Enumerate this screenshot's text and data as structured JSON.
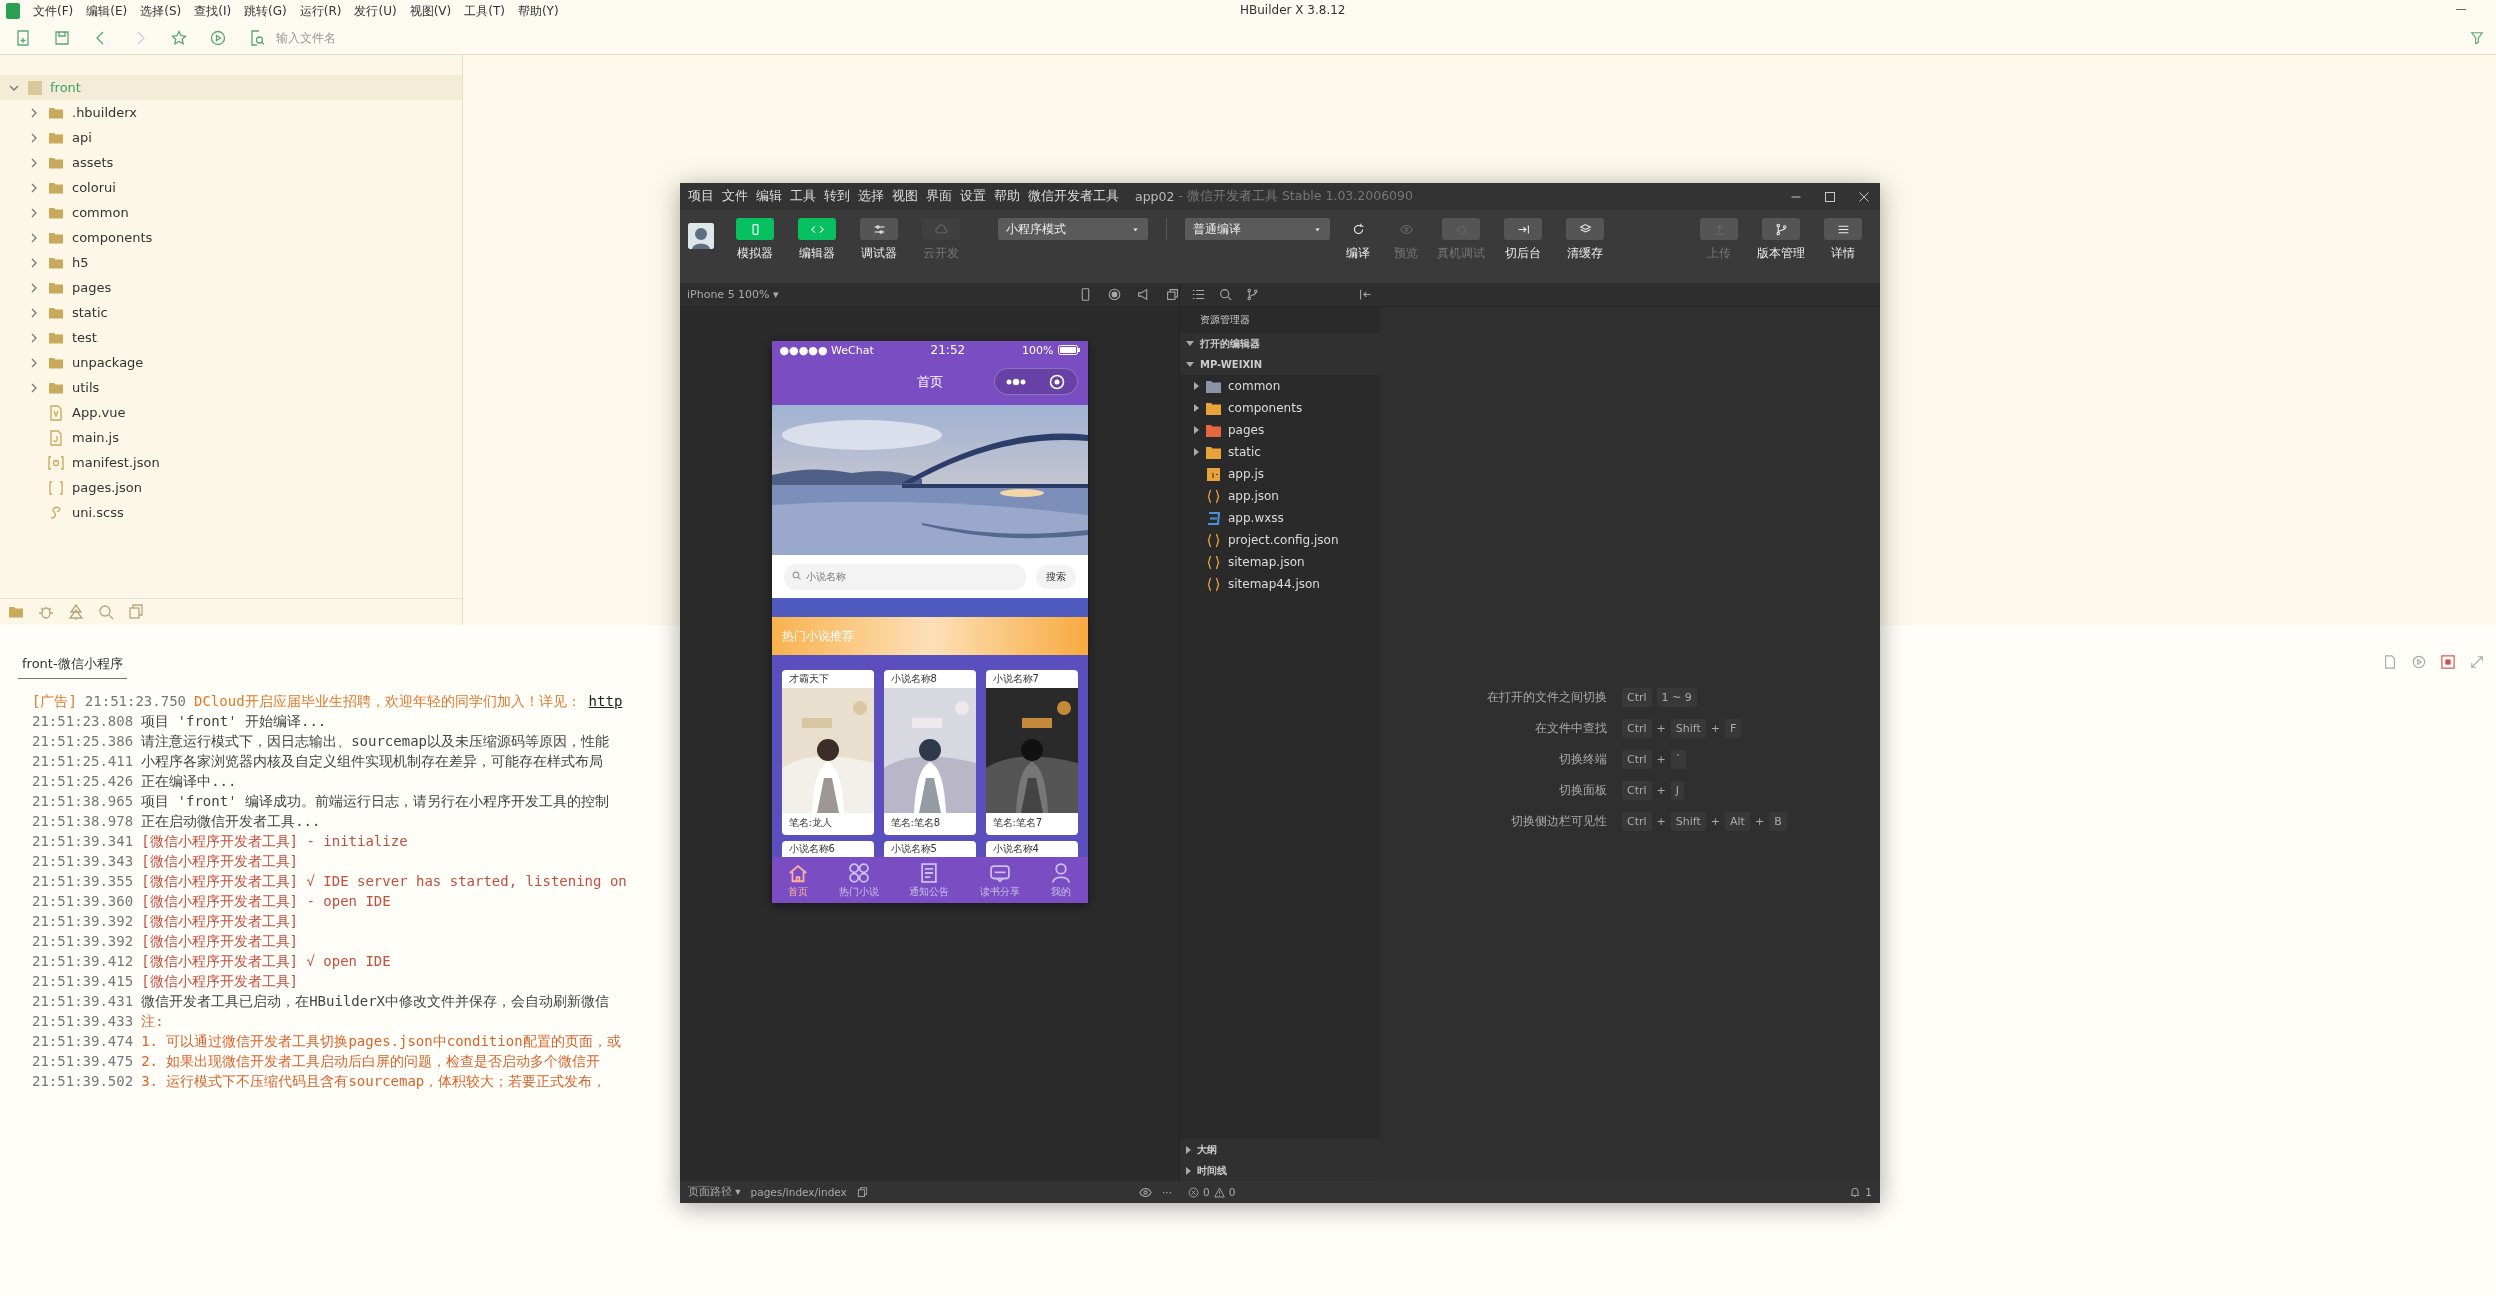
{
  "hbuilder": {
    "title": "HBuilder X 3.8.12",
    "menu": [
      "文件(F)",
      "编辑(E)",
      "选择(S)",
      "查找(I)",
      "跳转(G)",
      "运行(R)",
      "发行(U)",
      "视图(V)",
      "工具(T)",
      "帮助(Y)"
    ],
    "file_search": {
      "placeholder": "输入文件名"
    },
    "project": {
      "name": "front",
      "expanded": true,
      "children": [
        {
          "name": ".hbuilderx",
          "kind": "folder",
          "expanded": false
        },
        {
          "name": "api",
          "kind": "folder",
          "expanded": false
        },
        {
          "name": "assets",
          "kind": "folder",
          "expanded": false
        },
        {
          "name": "colorui",
          "kind": "folder",
          "expanded": false
        },
        {
          "name": "common",
          "kind": "folder",
          "expanded": false
        },
        {
          "name": "components",
          "kind": "folder",
          "expanded": false
        },
        {
          "name": "h5",
          "kind": "folder",
          "expanded": false
        },
        {
          "name": "pages",
          "kind": "folder",
          "expanded": false
        },
        {
          "name": "static",
          "kind": "folder",
          "expanded": false
        },
        {
          "name": "test",
          "kind": "folder",
          "expanded": false
        },
        {
          "name": "unpackage",
          "kind": "folder",
          "expanded": false
        },
        {
          "name": "utils",
          "kind": "folder",
          "expanded": false
        },
        {
          "name": "App.vue",
          "kind": "vue"
        },
        {
          "name": "main.js",
          "kind": "js"
        },
        {
          "name": "manifest.json",
          "kind": "config"
        },
        {
          "name": "pages.json",
          "kind": "json"
        },
        {
          "name": "uni.scss",
          "kind": "style"
        }
      ]
    },
    "console": {
      "tab": "front-微信小程序",
      "lines": [
        {
          "kind": "ad",
          "tag": "[广告]",
          "time": "21:51:23.750",
          "text": "DCloud开启应届毕业生招聘，欢迎年轻的同学们加入！详见：",
          "link": "http"
        },
        {
          "kind": "normal",
          "time": "21:51:23.808",
          "text": "项目 'front' 开始编译..."
        },
        {
          "kind": "normal",
          "time": "21:51:25.386",
          "text": "请注意运行模式下，因日志输出、sourcemap以及未压缩源码等原因，性能"
        },
        {
          "kind": "normal",
          "time": "21:51:25.411",
          "text": "小程序各家浏览器内核及自定义组件实现机制存在差异，可能存在样式布局"
        },
        {
          "kind": "normal",
          "time": "21:51:25.426",
          "text": "正在编译中..."
        },
        {
          "kind": "normal",
          "time": "21:51:38.965",
          "text": "项目 'front' 编译成功。前端运行日志，请另行在小程序开发工具的控制"
        },
        {
          "kind": "normal",
          "time": "21:51:38.978",
          "text": "正在启动微信开发者工具..."
        },
        {
          "kind": "tool",
          "time": "21:51:39.341",
          "text": "[微信小程序开发者工具] - initialize"
        },
        {
          "kind": "tool",
          "time": "21:51:39.343",
          "text": "[微信小程序开发者工具]"
        },
        {
          "kind": "tool",
          "time": "21:51:39.355",
          "text": "[微信小程序开发者工具] √ IDE server has started, listening on"
        },
        {
          "kind": "tool",
          "time": "21:51:39.360",
          "text": "[微信小程序开发者工具] - open IDE"
        },
        {
          "kind": "tool",
          "time": "21:51:39.392",
          "text": "[微信小程序开发者工具]"
        },
        {
          "kind": "tool",
          "time": "21:51:39.392",
          "text": "[微信小程序开发者工具]"
        },
        {
          "kind": "tool",
          "time": "21:51:39.412",
          "text": "[微信小程序开发者工具] √ open IDE"
        },
        {
          "kind": "tool",
          "time": "21:51:39.415",
          "text": "[微信小程序开发者工具]"
        },
        {
          "kind": "normal",
          "time": "21:51:39.431",
          "text": "微信开发者工具已启动，在HBuilderX中修改文件并保存，会自动刷新微信"
        },
        {
          "kind": "note",
          "time": "21:51:39.433",
          "text": "注:"
        },
        {
          "kind": "note",
          "time": "21:51:39.474",
          "text": "1. 可以通过微信开发者工具切换pages.json中condition配置的页面，或"
        },
        {
          "kind": "note",
          "time": "21:51:39.475",
          "text": "2. 如果出现微信开发者工具启动后白屏的问题，检查是否启动多个微信开"
        },
        {
          "kind": "note",
          "time": "21:51:39.502",
          "text": "3. 运行模式下不压缩代码且含有sourcemap，体积较大；若要正式发布，"
        }
      ]
    }
  },
  "devtools": {
    "menu": [
      "项目",
      "文件",
      "编辑",
      "工具",
      "转到",
      "选择",
      "视图",
      "界面",
      "设置",
      "帮助",
      "微信开发者工具"
    ],
    "title": "app02",
    "subtitle": "- 微信开发者工具 Stable 1.03.2006090",
    "view_buttons": [
      {
        "label": "模拟器",
        "selected": true,
        "disabled": false
      },
      {
        "label": "编辑器",
        "selected": true,
        "disabled": false
      },
      {
        "label": "调试器",
        "selected": false,
        "disabled": false
      },
      {
        "label": "云开发",
        "selected": false,
        "disabled": true
      }
    ],
    "mode_select": "小程序模式",
    "compile_select": "普通编译",
    "actions": [
      {
        "label": "编译",
        "disabled": false
      },
      {
        "label": "预览",
        "disabled": true
      },
      {
        "label": "真机调试",
        "disabled": true
      },
      {
        "label": "切后台",
        "disabled": false
      },
      {
        "label": "清缓存",
        "disabled": false
      }
    ],
    "right_actions": [
      {
        "label": "上传",
        "disabled": true
      },
      {
        "label": "版本管理",
        "disabled": false
      },
      {
        "label": "详情",
        "disabled": false
      }
    ],
    "device": "iPhone 5 100% ▾",
    "phone": {
      "carrier": "●●●●● WeChat",
      "time": "21:52",
      "battery": "100%",
      "nav_title": "首页",
      "search": {
        "placeholder": "小说名称",
        "button": "搜索"
      },
      "section_title": "热门小说推荐",
      "books": [
        {
          "title": "才霸天下",
          "author": "笔名:龙人"
        },
        {
          "title": "小说名称8",
          "author": "笔名:笔名8"
        },
        {
          "title": "小说名称7",
          "author": "笔名:笔名7"
        }
      ],
      "more_books": [
        "小说名称6",
        "小说名称5",
        "小说名称4"
      ],
      "tabs": [
        {
          "label": "首页",
          "selected": true
        },
        {
          "label": "热门小说",
          "selected": false
        },
        {
          "label": "通知公告",
          "selected": false
        },
        {
          "label": "读书分享",
          "selected": false
        },
        {
          "label": "我的",
          "selected": false
        }
      ]
    },
    "explorer": {
      "title": "资源管理器",
      "sections": [
        {
          "label": "打开的编辑器",
          "expanded": true
        },
        {
          "label": "MP-WEIXIN",
          "expanded": true
        }
      ],
      "files": [
        {
          "name": "common",
          "kind": "folder",
          "color": "#8a96a8",
          "expanded": false
        },
        {
          "name": "components",
          "kind": "folder",
          "color": "#e8a33a",
          "expanded": false
        },
        {
          "name": "pages",
          "kind": "folder",
          "color": "#e5673d",
          "expanded": false
        },
        {
          "name": "static",
          "kind": "folder",
          "color": "#e8a33a",
          "expanded": false
        },
        {
          "name": "app.js",
          "kind": "js"
        },
        {
          "name": "app.json",
          "kind": "json"
        },
        {
          "name": "app.wxss",
          "kind": "wxss"
        },
        {
          "name": "project.config.json",
          "kind": "json"
        },
        {
          "name": "sitemap.json",
          "kind": "json"
        },
        {
          "name": "sitemap44.json",
          "kind": "json"
        }
      ],
      "bottom_sections": [
        {
          "label": "大纲",
          "expanded": false
        },
        {
          "label": "时间线",
          "expanded": false
        }
      ]
    },
    "shortcuts": [
      {
        "label": "在打开的文件之间切换",
        "keys": [
          {
            "kind": "key",
            "text": "Ctrl"
          },
          {
            "kind": "key",
            "text": "1 ~ 9"
          }
        ]
      },
      {
        "label": "在文件中查找",
        "keys": [
          {
            "kind": "key",
            "text": "Ctrl"
          },
          {
            "kind": "plus",
            "text": "+"
          },
          {
            "kind": "key",
            "text": "Shift"
          },
          {
            "kind": "plus",
            "text": "+"
          },
          {
            "kind": "key",
            "text": "F"
          }
        ]
      },
      {
        "label": "切换终端",
        "keys": [
          {
            "kind": "key",
            "text": "Ctrl"
          },
          {
            "kind": "plus",
            "text": "+"
          },
          {
            "kind": "key",
            "text": "`"
          }
        ]
      },
      {
        "label": "切换面板",
        "keys": [
          {
            "kind": "key",
            "text": "Ctrl"
          },
          {
            "kind": "plus",
            "text": "+"
          },
          {
            "kind": "key",
            "text": "J"
          }
        ]
      },
      {
        "label": "切换侧边栏可见性",
        "keys": [
          {
            "kind": "key",
            "text": "Ctrl"
          },
          {
            "kind": "plus",
            "text": "+"
          },
          {
            "kind": "key",
            "text": "Shift"
          },
          {
            "kind": "plus",
            "text": "+"
          },
          {
            "kind": "key",
            "text": "Alt"
          },
          {
            "kind": "plus",
            "text": "+"
          },
          {
            "kind": "key",
            "text": "B"
          }
        ]
      }
    ],
    "status": {
      "page_path_label": "页面路径 ▾",
      "page_path": "pages/index/index",
      "more": "···",
      "errors": "0",
      "warnings": "0",
      "notifications": "1"
    }
  }
}
